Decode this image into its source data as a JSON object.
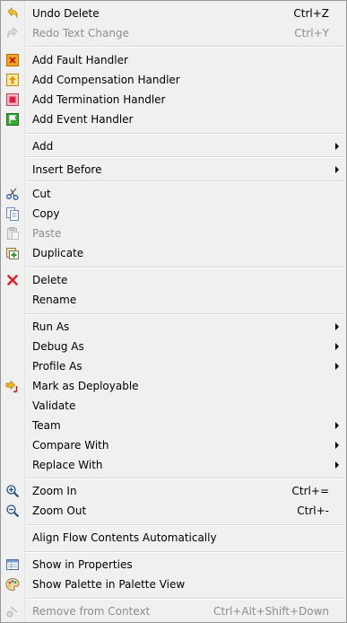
{
  "menu": {
    "items": [
      {
        "label": "Undo Delete",
        "shortcut": "Ctrl+Z",
        "icon": "undo-icon",
        "enabled": true
      },
      {
        "label": "Redo Text Change",
        "shortcut": "Ctrl+Y",
        "icon": "redo-icon",
        "enabled": false
      },
      {
        "label": "Add Fault Handler",
        "icon": "fault-handler-icon",
        "enabled": true
      },
      {
        "label": "Add Compensation Handler",
        "icon": "compensation-handler-icon",
        "enabled": true
      },
      {
        "label": "Add Termination Handler",
        "icon": "termination-handler-icon",
        "enabled": true
      },
      {
        "label": "Add Event Handler",
        "icon": "event-handler-icon",
        "enabled": true
      },
      {
        "label": "Add",
        "submenu": true,
        "enabled": true
      },
      {
        "label": "Insert Before",
        "submenu": true,
        "enabled": true
      },
      {
        "label": "Cut",
        "icon": "scissors-icon",
        "enabled": true
      },
      {
        "label": "Copy",
        "icon": "copy-icon",
        "enabled": true
      },
      {
        "label": "Paste",
        "icon": "paste-icon",
        "enabled": false
      },
      {
        "label": "Duplicate",
        "icon": "duplicate-icon",
        "enabled": true
      },
      {
        "label": "Delete",
        "icon": "delete-x-icon",
        "enabled": true
      },
      {
        "label": "Rename",
        "enabled": true
      },
      {
        "label": "Run As",
        "submenu": true,
        "enabled": true
      },
      {
        "label": "Debug As",
        "submenu": true,
        "enabled": true
      },
      {
        "label": "Profile As",
        "submenu": true,
        "enabled": true
      },
      {
        "label": "Mark as Deployable",
        "icon": "deployable-icon",
        "enabled": true
      },
      {
        "label": "Validate",
        "enabled": true
      },
      {
        "label": "Team",
        "submenu": true,
        "enabled": true
      },
      {
        "label": "Compare With",
        "submenu": true,
        "enabled": true
      },
      {
        "label": "Replace With",
        "submenu": true,
        "enabled": true
      },
      {
        "label": "Zoom In",
        "shortcut": "Ctrl+=",
        "icon": "zoom-in-icon",
        "enabled": true
      },
      {
        "label": "Zoom Out",
        "shortcut": "Ctrl+-",
        "icon": "zoom-out-icon",
        "enabled": true
      },
      {
        "label": "Align Flow Contents Automatically",
        "enabled": true
      },
      {
        "label": "Show in Properties",
        "icon": "properties-icon",
        "enabled": true
      },
      {
        "label": "Show Palette in Palette View",
        "icon": "palette-icon",
        "enabled": true
      },
      {
        "label": "Remove from Context",
        "shortcut": "Ctrl+Alt+Shift+Down",
        "icon": "remove-context-icon",
        "enabled": false
      }
    ]
  }
}
